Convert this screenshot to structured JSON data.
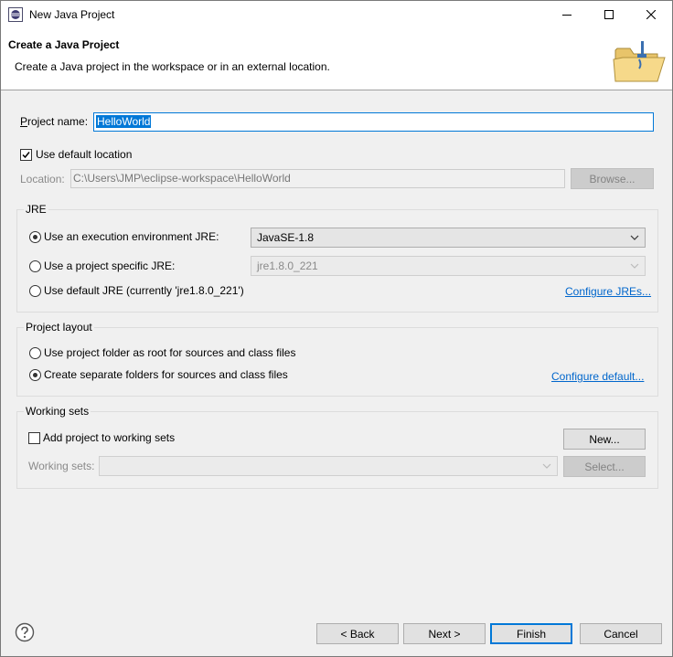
{
  "window": {
    "title": "New Java Project",
    "controls": [
      "minimize-icon",
      "maximize-icon",
      "close-icon"
    ]
  },
  "banner": {
    "title": "Create a Java Project",
    "description": "Create a Java project in the workspace or in an external location.",
    "icon": "java-project-folder-icon"
  },
  "project_name": {
    "label": "Project name:",
    "value": "HelloWorld"
  },
  "default_location": {
    "checkbox_label": "Use default location",
    "checked": true,
    "location_label": "Location:",
    "location_value": "C:\\Users\\JMP\\eclipse-workspace\\HelloWorld",
    "browse_label": "Browse..."
  },
  "jre": {
    "group_title": "JRE",
    "option_execution_env": "Use an execution environment JRE:",
    "option_execution_env_selected": true,
    "execution_env_value": "JavaSE-1.8",
    "option_project_specific": "Use a project specific JRE:",
    "project_specific_value": "jre1.8.0_221",
    "option_default": "Use default JRE (currently 'jre1.8.0_221')",
    "configure_link": "Configure JREs..."
  },
  "project_layout": {
    "group_title": "Project layout",
    "option_root": "Use project folder as root for sources and class files",
    "option_separate": "Create separate folders for sources and class files",
    "option_separate_selected": true,
    "configure_link": "Configure default..."
  },
  "working_sets": {
    "group_title": "Working sets",
    "add_label": "Add project to working sets",
    "add_checked": false,
    "new_button": "New...",
    "sets_label": "Working sets:",
    "sets_value": "",
    "select_button": "Select..."
  },
  "footer": {
    "help_icon": "help-icon",
    "back_button": "< Back",
    "next_button": "Next >",
    "finish_button": "Finish",
    "cancel_button": "Cancel"
  }
}
